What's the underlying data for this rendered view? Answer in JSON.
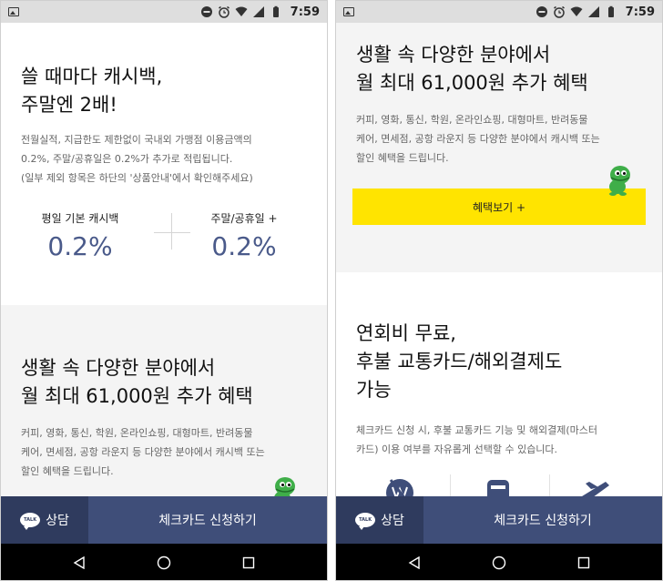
{
  "statusbar": {
    "time": "7:59"
  },
  "left": {
    "section1": {
      "heading_line1": "쓸 때마다 캐시백,",
      "heading_line2": "주말엔 2배!",
      "desc_line1": "전월실적, 지급한도 제한없이 국내외 가맹점 이용금액의",
      "desc_line2": "0.2%, 주말/공휴일은 0.2%가 추가로 적립됩니다.",
      "desc_line3": "(일부 제외 항목은 하단의 '상품안내'에서 확인해주세요)"
    },
    "rates": [
      {
        "label": "평일 기본 캐시백",
        "value": "0.2%"
      },
      {
        "label": "주말/공휴일 +",
        "value": "0.2%"
      }
    ],
    "section2": {
      "heading_line1": "생활 속 다양한 분야에서",
      "heading_line2": "월 최대 61,000원 추가 혜택",
      "desc_line1": "커피, 영화, 통신, 학원, 온라인쇼핑, 대형마트, 반려동물",
      "desc_line2": "케어, 면세점, 공항 라운지 등 다양한 분야에서 캐시백 또는",
      "desc_line3": "할인 혜택을 드립니다."
    }
  },
  "right": {
    "section1": {
      "heading_line1": "생활 속 다양한 분야에서",
      "heading_line2": "월 최대 61,000원 추가 혜택",
      "desc_line1": "커피, 영화, 통신, 학원, 온라인쇼핑, 대형마트, 반려동물",
      "desc_line2": "케어, 면세점, 공항 라운지 등 다양한 분야에서 캐시백 또는",
      "desc_line3": "할인 혜택을 드립니다.",
      "button_label": "혜택보기 +"
    },
    "section2": {
      "heading_line1": "연회비 무료,",
      "heading_line2": "후불 교통카드/해외결제도",
      "heading_line3": "가능",
      "desc_line1": "체크카드 신청 시, 후불 교통카드 기능 및 해외결제(마스터",
      "desc_line2": "카드) 이용 여부를 자유롭게 선택할 수 있습니다."
    },
    "feature_icons": [
      "no-fee-icon",
      "bus-icon",
      "airplane-icon"
    ]
  },
  "bottombar": {
    "talk_badge": "TALK",
    "talk_label": "상담",
    "apply_label": "체크카드 신청하기"
  },
  "colors": {
    "accent_navy": "#3f4e79",
    "accent_navy_dark": "#2f3b5e",
    "rate_blue": "#4a5a8a",
    "benefit_yellow": "#ffe400",
    "character_green": "#3fae49"
  }
}
